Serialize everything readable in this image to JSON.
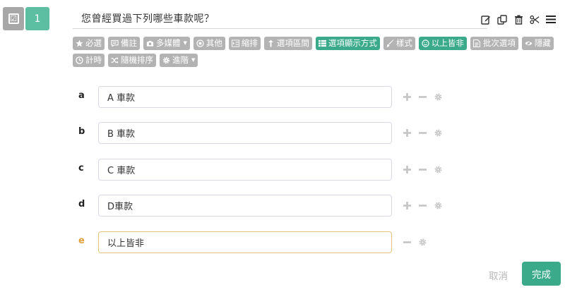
{
  "question": {
    "type_icon": "checkbox-icon",
    "type_glyph": "☑",
    "number": "1",
    "title": "您曾經買過下列哪些車款呢？"
  },
  "title_tools": [
    {
      "name": "edit-icon"
    },
    {
      "name": "copy-icon"
    },
    {
      "name": "trash-icon"
    },
    {
      "name": "scissors-icon"
    },
    {
      "name": "menu-icon"
    }
  ],
  "toolbar": {
    "required": "必選",
    "note": "備註",
    "media": "多媒體",
    "other": "其他",
    "indent": "縮排",
    "option_range": "選項區間",
    "option_display": "選項顯示方式",
    "style": "樣式",
    "none_of_above": "以上皆非",
    "batch_options": "批次選項",
    "hide": "隱藏",
    "timer": "計時",
    "shuffle": "隨機排序",
    "advanced": "進階"
  },
  "options": [
    {
      "label": "a",
      "value": "A 車款"
    },
    {
      "label": "b",
      "value": "B 車款"
    },
    {
      "label": "c",
      "value": "C 車款"
    },
    {
      "label": "d",
      "value": "D車款"
    },
    {
      "label": "e",
      "value": "以上皆非"
    }
  ],
  "footer": {
    "cancel": "取消",
    "done": "完成"
  },
  "colors": {
    "accent": "#3aaa8a",
    "number_box": "#5cbfa1",
    "gray_button": "#b3b3b3",
    "none_of_above_label": "#e0a03a"
  }
}
